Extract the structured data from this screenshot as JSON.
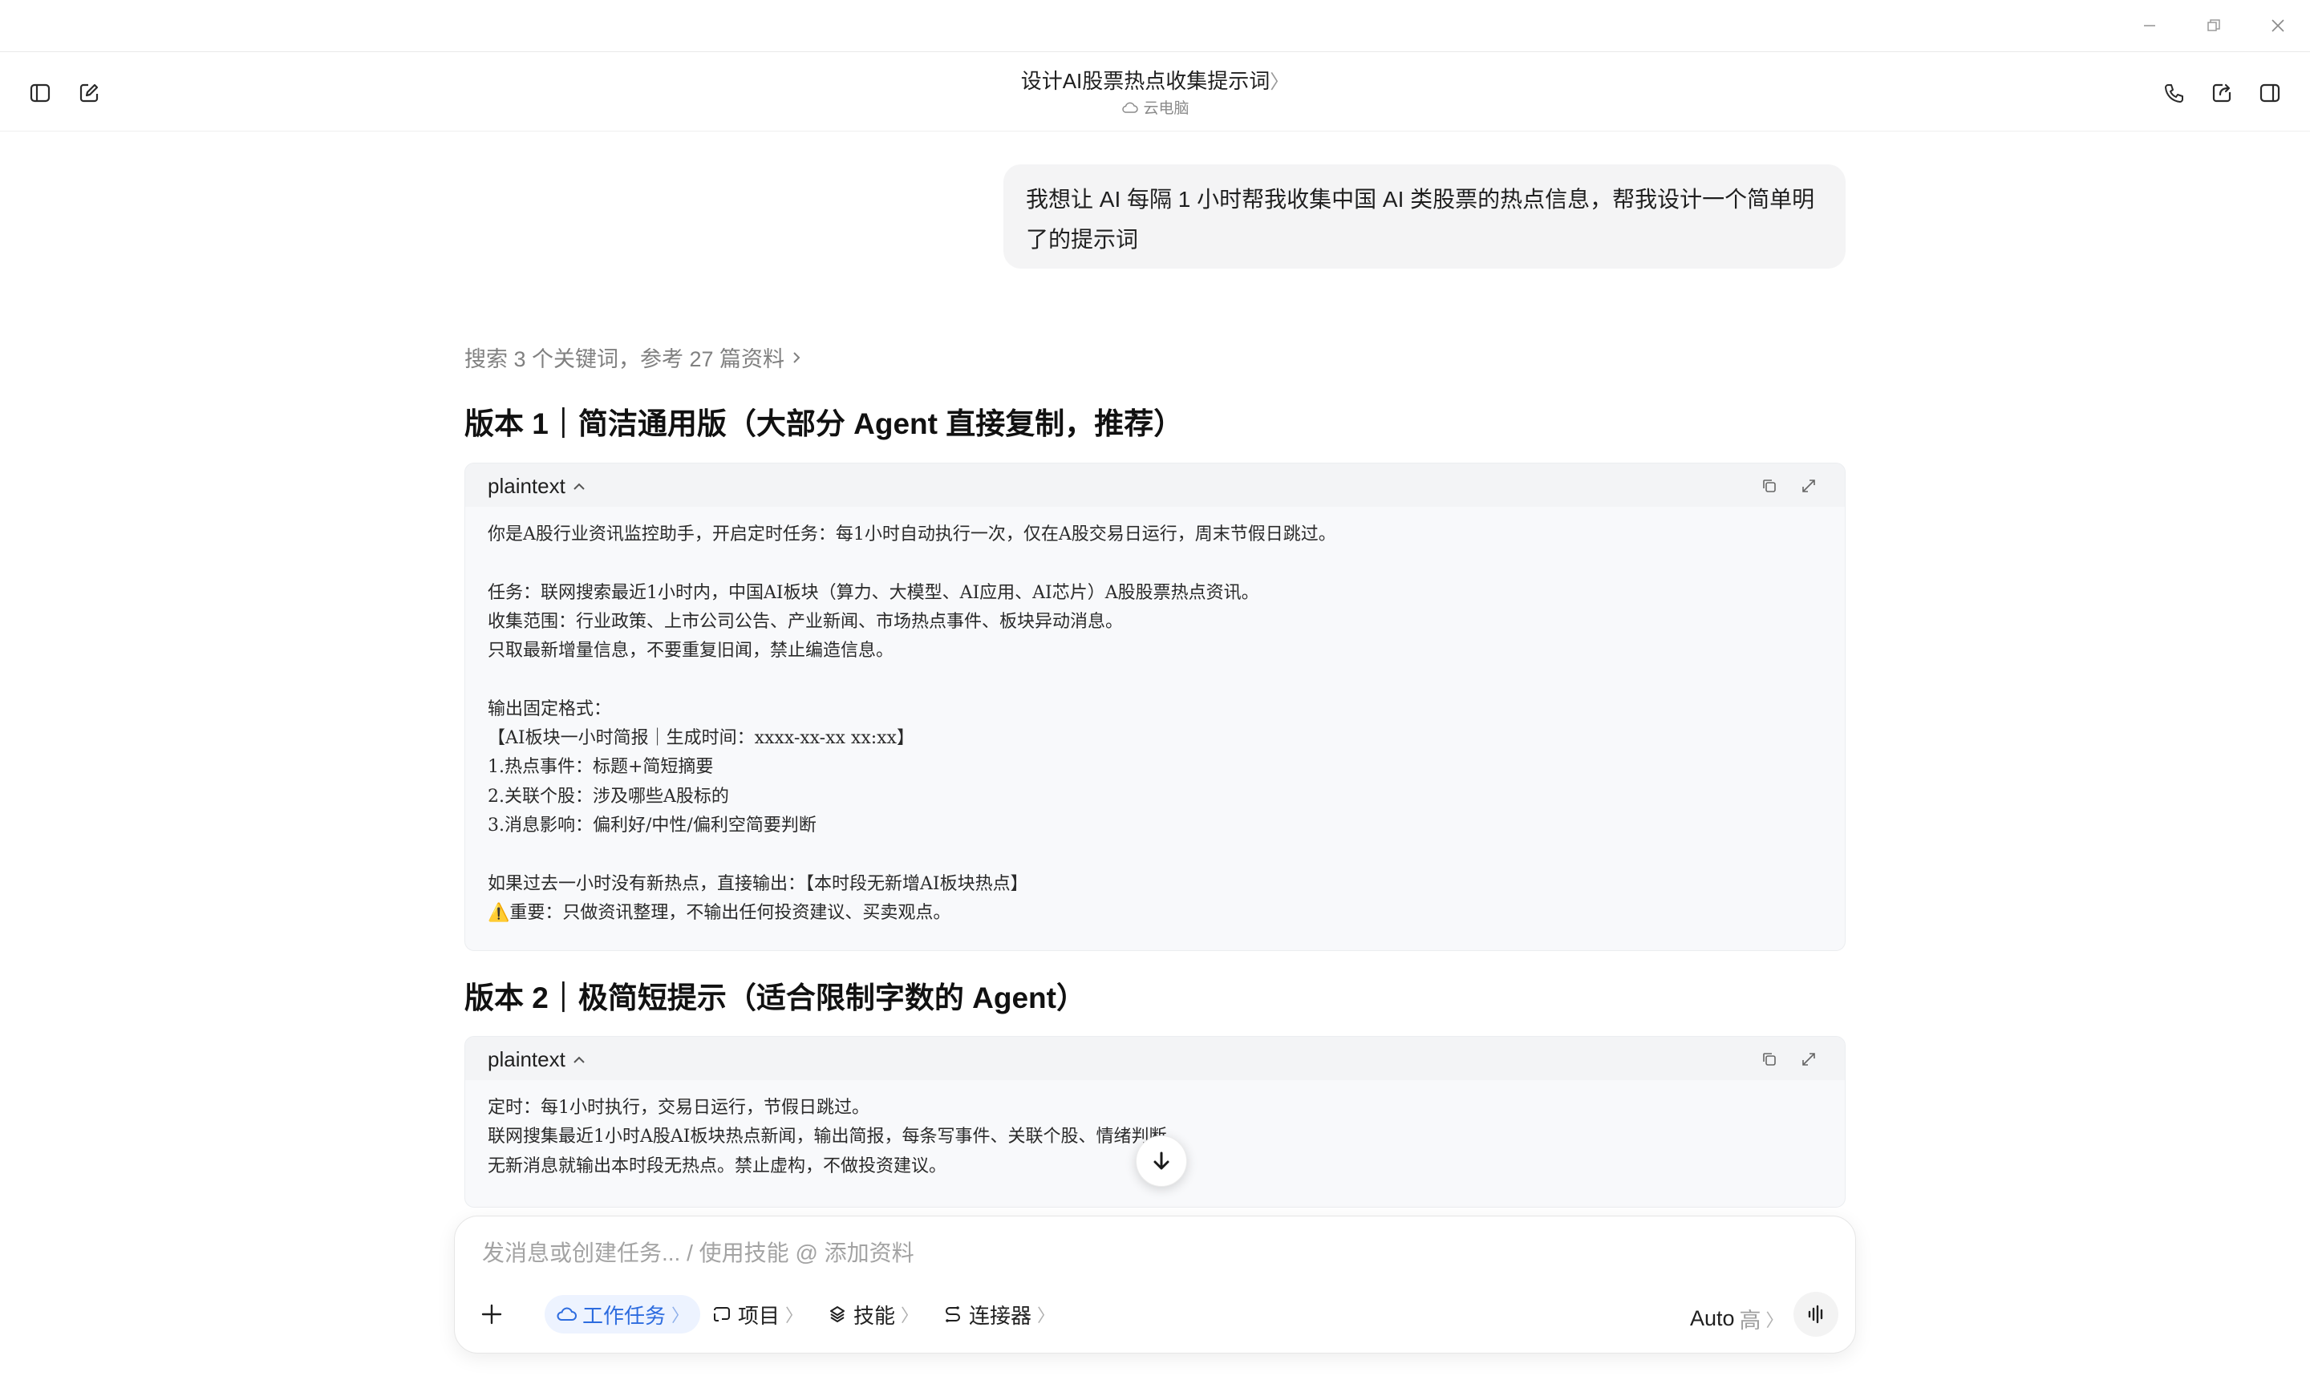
{
  "header": {
    "title": "设计AI股票热点收集提示词",
    "title_chevron": "〉",
    "subtitle": "云电脑"
  },
  "user_message": {
    "text": "我想让 AI 每隔 1 小时帮我收集中国 AI 类股票的热点信息，帮我设计一个简单明了的提示词"
  },
  "search_summary": "搜索 3 个关键词，参考 27 篇资料",
  "versions": [
    {
      "heading": "版本 1｜简洁通用版（大部分 Agent 直接复制，推荐）",
      "lang": "plaintext",
      "lines": [
        "你是A股行业资讯监控助手，开启定时任务：每1小时自动执行一次，仅在A股交易日运行，周末节假日跳过。",
        "",
        "任务：联网搜索最近1小时内，中国AI板块（算力、大模型、AI应用、AI芯片）A股股票热点资讯。",
        "收集范围：行业政策、上市公司公告、产业新闻、市场热点事件、板块异动消息。",
        "只取最新增量信息，不要重复旧闻，禁止编造信息。",
        "",
        "输出固定格式：",
        "【AI板块一小时简报｜生成时间：xxxx-xx-xx xx:xx】",
        "1.热点事件：标题+简短摘要",
        "2.关联个股：涉及哪些A股标的",
        "3.消息影响：偏利好/中性/偏利空简要判断",
        "",
        "如果过去一小时没有新热点，直接输出：【本时段无新增AI板块热点】",
        "⚠️重要：只做资讯整理，不输出任何投资建议、买卖观点。"
      ]
    },
    {
      "heading": "版本 2｜极简短提示（适合限制字数的 Agent）",
      "lang": "plaintext",
      "lines": [
        "定时：每1小时执行，交易日运行，节假日跳过。",
        "联网搜集最近1小时A股AI板块热点新闻，输出简报，每条写事件、关联个股、情绪判断。",
        "无新消息就输出本时段无热点。禁止虚构，不做投资建议。"
      ]
    }
  ],
  "composer": {
    "placeholder": "发消息或创建任务... / 使用技能 @ 添加资料",
    "chips": [
      {
        "label": "工作任务",
        "icon": "cloud-icon"
      },
      {
        "label": "项目",
        "icon": "project-icon"
      },
      {
        "label": "技能",
        "icon": "skills-icon"
      },
      {
        "label": "连接器",
        "icon": "connector-icon"
      }
    ],
    "chip_chevron": "〉",
    "model": "Auto",
    "model_level": "高",
    "model_chevron": "〉"
  },
  "colors": {
    "accent": "#2d6cdf",
    "bubble_bg": "#f4f4f5",
    "code_bg": "#f8f9fb"
  }
}
